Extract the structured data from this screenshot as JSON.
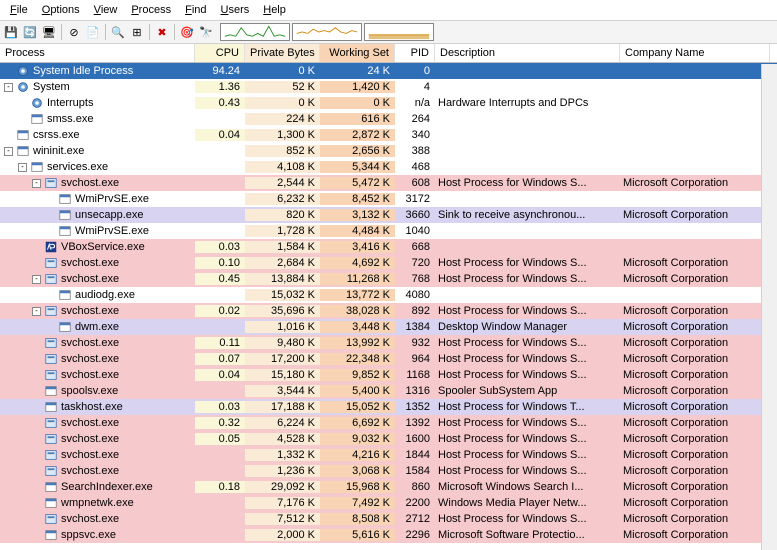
{
  "menu": [
    "File",
    "Options",
    "View",
    "Process",
    "Find",
    "Users",
    "Help"
  ],
  "toolbar_icons": [
    {
      "name": "save-icon",
      "glyph": "💾"
    },
    {
      "name": "refresh-icon",
      "glyph": "🔄"
    },
    {
      "name": "system-info-icon",
      "glyph": "🖥"
    },
    {
      "name": "sep"
    },
    {
      "name": "kill-icon",
      "glyph": "⊘"
    },
    {
      "name": "props-icon",
      "glyph": "📄"
    },
    {
      "name": "sep"
    },
    {
      "name": "find-handle-icon",
      "glyph": "🔍"
    },
    {
      "name": "find-window-icon",
      "glyph": "⊞"
    },
    {
      "name": "sep"
    },
    {
      "name": "kill-cross-icon",
      "glyph": "✖",
      "color": "#c00"
    },
    {
      "name": "sep"
    },
    {
      "name": "target-icon",
      "glyph": "🎯"
    },
    {
      "name": "binoculars-icon",
      "glyph": "🔭"
    }
  ],
  "columns": [
    {
      "key": "proc",
      "label": "Process",
      "cls": "c-proc"
    },
    {
      "key": "cpu",
      "label": "CPU",
      "cls": "c-cpu hl-cpu sort"
    },
    {
      "key": "priv",
      "label": "Private Bytes",
      "cls": "c-priv hl-priv"
    },
    {
      "key": "work",
      "label": "Working Set",
      "cls": "c-work hl-work"
    },
    {
      "key": "pid",
      "label": "PID",
      "cls": "c-pid"
    },
    {
      "key": "desc",
      "label": "Description",
      "cls": "c-desc"
    },
    {
      "key": "comp",
      "label": "Company Name",
      "cls": "c-comp"
    }
  ],
  "processes": [
    {
      "d": 0,
      "t": "",
      "ico": "gear",
      "name": "System Idle Process",
      "cpu": "94.24",
      "priv": "0 K",
      "work": "24 K",
      "pid": "0",
      "desc": "",
      "comp": "",
      "cls": "sel"
    },
    {
      "d": 0,
      "t": "-",
      "ico": "gear",
      "name": "System",
      "cpu": "1.36",
      "priv": "52 K",
      "work": "1,420 K",
      "pid": "4",
      "desc": "",
      "comp": ""
    },
    {
      "d": 1,
      "t": "",
      "ico": "gear",
      "name": "Interrupts",
      "cpu": "0.43",
      "priv": "0 K",
      "work": "0 K",
      "pid": "n/a",
      "desc": "Hardware Interrupts and DPCs",
      "comp": ""
    },
    {
      "d": 1,
      "t": "",
      "ico": "app",
      "name": "smss.exe",
      "cpu": "",
      "priv": "224 K",
      "work": "616 K",
      "pid": "264",
      "desc": "",
      "comp": ""
    },
    {
      "d": 0,
      "t": "",
      "ico": "app",
      "name": "csrss.exe",
      "cpu": "0.04",
      "priv": "1,300 K",
      "work": "2,872 K",
      "pid": "340",
      "desc": "",
      "comp": ""
    },
    {
      "d": 0,
      "t": "-",
      "ico": "app",
      "name": "wininit.exe",
      "cpu": "",
      "priv": "852 K",
      "work": "2,656 K",
      "pid": "388",
      "desc": "",
      "comp": ""
    },
    {
      "d": 1,
      "t": "-",
      "ico": "app",
      "name": "services.exe",
      "cpu": "",
      "priv": "4,108 K",
      "work": "5,344 K",
      "pid": "468",
      "desc": "",
      "comp": ""
    },
    {
      "d": 2,
      "t": "-",
      "ico": "svc",
      "name": "svchost.exe",
      "cpu": "",
      "priv": "2,544 K",
      "work": "5,472 K",
      "pid": "608",
      "desc": "Host Process for Windows S...",
      "comp": "Microsoft Corporation",
      "cls": "pink"
    },
    {
      "d": 3,
      "t": "",
      "ico": "app",
      "name": "WmiPrvSE.exe",
      "cpu": "",
      "priv": "6,232 K",
      "work": "8,452 K",
      "pid": "3172",
      "desc": "",
      "comp": ""
    },
    {
      "d": 3,
      "t": "",
      "ico": "app",
      "name": "unsecapp.exe",
      "cpu": "",
      "priv": "820 K",
      "work": "3,132 K",
      "pid": "3660",
      "desc": "Sink to receive asynchronou...",
      "comp": "Microsoft Corporation",
      "cls": "lav"
    },
    {
      "d": 3,
      "t": "",
      "ico": "app",
      "name": "WmiPrvSE.exe",
      "cpu": "",
      "priv": "1,728 K",
      "work": "4,484 K",
      "pid": "1040",
      "desc": "",
      "comp": ""
    },
    {
      "d": 2,
      "t": "",
      "ico": "vbox",
      "name": "VBoxService.exe",
      "cpu": "0.03",
      "priv": "1,584 K",
      "work": "3,416 K",
      "pid": "668",
      "desc": "",
      "comp": "",
      "cls": "pink"
    },
    {
      "d": 2,
      "t": "",
      "ico": "svc",
      "name": "svchost.exe",
      "cpu": "0.10",
      "priv": "2,684 K",
      "work": "4,692 K",
      "pid": "720",
      "desc": "Host Process for Windows S...",
      "comp": "Microsoft Corporation",
      "cls": "pink"
    },
    {
      "d": 2,
      "t": "-",
      "ico": "svc",
      "name": "svchost.exe",
      "cpu": "0.45",
      "priv": "13,884 K",
      "work": "11,268 K",
      "pid": "768",
      "desc": "Host Process for Windows S...",
      "comp": "Microsoft Corporation",
      "cls": "pink"
    },
    {
      "d": 3,
      "t": "",
      "ico": "app",
      "name": "audiodg.exe",
      "cpu": "",
      "priv": "15,032 K",
      "work": "13,772 K",
      "pid": "4080",
      "desc": "",
      "comp": ""
    },
    {
      "d": 2,
      "t": "-",
      "ico": "svc",
      "name": "svchost.exe",
      "cpu": "0.02",
      "priv": "35,696 K",
      "work": "38,028 K",
      "pid": "892",
      "desc": "Host Process for Windows S...",
      "comp": "Microsoft Corporation",
      "cls": "pink"
    },
    {
      "d": 3,
      "t": "",
      "ico": "app",
      "name": "dwm.exe",
      "cpu": "",
      "priv": "1,016 K",
      "work": "3,448 K",
      "pid": "1384",
      "desc": "Desktop Window Manager",
      "comp": "Microsoft Corporation",
      "cls": "lav"
    },
    {
      "d": 2,
      "t": "",
      "ico": "svc",
      "name": "svchost.exe",
      "cpu": "0.11",
      "priv": "9,480 K",
      "work": "13,992 K",
      "pid": "932",
      "desc": "Host Process for Windows S...",
      "comp": "Microsoft Corporation",
      "cls": "pink"
    },
    {
      "d": 2,
      "t": "",
      "ico": "svc",
      "name": "svchost.exe",
      "cpu": "0.07",
      "priv": "17,200 K",
      "work": "22,348 K",
      "pid": "964",
      "desc": "Host Process for Windows S...",
      "comp": "Microsoft Corporation",
      "cls": "pink"
    },
    {
      "d": 2,
      "t": "",
      "ico": "svc",
      "name": "svchost.exe",
      "cpu": "0.04",
      "priv": "15,180 K",
      "work": "9,852 K",
      "pid": "1168",
      "desc": "Host Process for Windows S...",
      "comp": "Microsoft Corporation",
      "cls": "pink"
    },
    {
      "d": 2,
      "t": "",
      "ico": "app",
      "name": "spoolsv.exe",
      "cpu": "",
      "priv": "3,544 K",
      "work": "5,400 K",
      "pid": "1316",
      "desc": "Spooler SubSystem App",
      "comp": "Microsoft Corporation",
      "cls": "pink"
    },
    {
      "d": 2,
      "t": "",
      "ico": "app",
      "name": "taskhost.exe",
      "cpu": "0.03",
      "priv": "17,188 K",
      "work": "15,052 K",
      "pid": "1352",
      "desc": "Host Process for Windows T...",
      "comp": "Microsoft Corporation",
      "cls": "lav"
    },
    {
      "d": 2,
      "t": "",
      "ico": "svc",
      "name": "svchost.exe",
      "cpu": "0.32",
      "priv": "6,224 K",
      "work": "6,692 K",
      "pid": "1392",
      "desc": "Host Process for Windows S...",
      "comp": "Microsoft Corporation",
      "cls": "pink"
    },
    {
      "d": 2,
      "t": "",
      "ico": "svc",
      "name": "svchost.exe",
      "cpu": "0.05",
      "priv": "4,528 K",
      "work": "9,032 K",
      "pid": "1600",
      "desc": "Host Process for Windows S...",
      "comp": "Microsoft Corporation",
      "cls": "pink"
    },
    {
      "d": 2,
      "t": "",
      "ico": "svc",
      "name": "svchost.exe",
      "cpu": "",
      "priv": "1,332 K",
      "work": "4,216 K",
      "pid": "1844",
      "desc": "Host Process for Windows S...",
      "comp": "Microsoft Corporation",
      "cls": "pink"
    },
    {
      "d": 2,
      "t": "",
      "ico": "svc",
      "name": "svchost.exe",
      "cpu": "",
      "priv": "1,236 K",
      "work": "3,068 K",
      "pid": "1584",
      "desc": "Host Process for Windows S...",
      "comp": "Microsoft Corporation",
      "cls": "pink"
    },
    {
      "d": 2,
      "t": "",
      "ico": "app",
      "name": "SearchIndexer.exe",
      "cpu": "0.18",
      "priv": "29,092 K",
      "work": "15,968 K",
      "pid": "860",
      "desc": "Microsoft Windows Search I...",
      "comp": "Microsoft Corporation",
      "cls": "pink"
    },
    {
      "d": 2,
      "t": "",
      "ico": "app",
      "name": "wmpnetwk.exe",
      "cpu": "",
      "priv": "7,176 K",
      "work": "7,492 K",
      "pid": "2200",
      "desc": "Windows Media Player Netw...",
      "comp": "Microsoft Corporation",
      "cls": "pink"
    },
    {
      "d": 2,
      "t": "",
      "ico": "svc",
      "name": "svchost.exe",
      "cpu": "",
      "priv": "7,512 K",
      "work": "8,508 K",
      "pid": "2712",
      "desc": "Host Process for Windows S...",
      "comp": "Microsoft Corporation",
      "cls": "pink"
    },
    {
      "d": 2,
      "t": "",
      "ico": "app",
      "name": "sppsvc.exe",
      "cpu": "",
      "priv": "2,000 K",
      "work": "5,616 K",
      "pid": "2296",
      "desc": "Microsoft Software Protectio...",
      "comp": "Microsoft Corporation",
      "cls": "pink"
    }
  ],
  "chart_data": {
    "type": "line",
    "note": "three mini activity graphs in toolbar — approximate shapes only",
    "graphs": [
      {
        "color": "#1e8a1e",
        "values": [
          2,
          3,
          2,
          8,
          3,
          2,
          4,
          2,
          9,
          2,
          3,
          2
        ]
      },
      {
        "color": "#cc8400",
        "values": [
          4,
          5,
          4,
          7,
          5,
          6,
          5,
          8,
          5,
          4,
          6,
          5
        ]
      },
      {
        "color": "#cc8400",
        "values": [
          3,
          3,
          3,
          3,
          3,
          3,
          3,
          3,
          3,
          3,
          3,
          3
        ],
        "fill": true
      }
    ]
  }
}
